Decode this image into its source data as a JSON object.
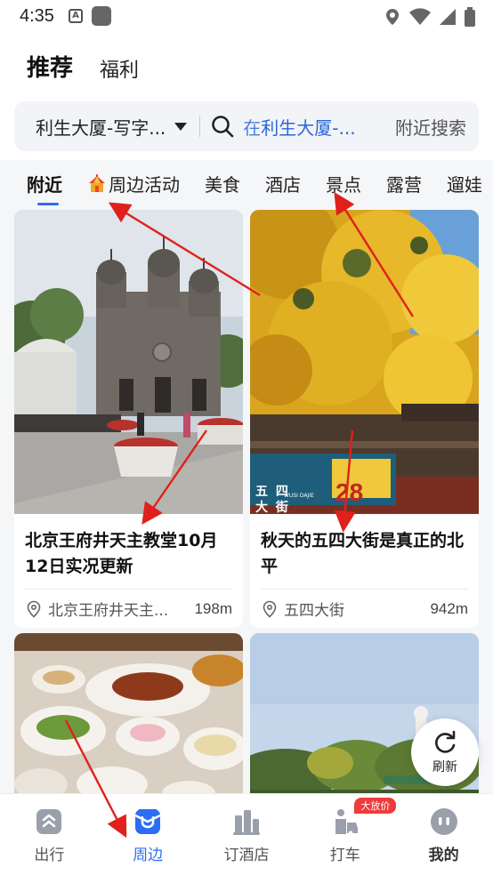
{
  "status_bar": {
    "time": "4:35",
    "a_glyph": "A"
  },
  "top_tabs": [
    {
      "label": "推荐",
      "active": true
    },
    {
      "label": "福利",
      "active": false
    }
  ],
  "search": {
    "location": "利生大厦-写字...",
    "hint_prefix": "在",
    "hint_place": "利生大厦-...",
    "nearby_button": "附近搜索"
  },
  "categories": [
    "附近",
    "周边活动",
    "美食",
    "酒店",
    "景点",
    "露营",
    "遛娃"
  ],
  "cards": [
    {
      "title": "北京王府井天主教堂10月12日实况更新",
      "location": "北京王府井天主...",
      "distance": "198m"
    },
    {
      "title": "秋天的五四大街是真正的北平",
      "location": "五四大街",
      "distance": "942m"
    },
    {
      "title": "",
      "location": "",
      "distance": ""
    },
    {
      "title": "",
      "location": "",
      "distance": ""
    }
  ],
  "street_sign": {
    "row1": "五 四",
    "row2": "大 街",
    "number": "28",
    "romanized": "WUSI DAJIE"
  },
  "refresh": {
    "label": "刷新"
  },
  "bottom_nav": [
    {
      "label": "出行",
      "icon": "travel-icon",
      "active": false
    },
    {
      "label": "周边",
      "icon": "nearby-icon",
      "active": true
    },
    {
      "label": "订酒店",
      "icon": "hotel-icon",
      "active": false
    },
    {
      "label": "打车",
      "icon": "taxi-icon",
      "active": false,
      "badge": "大放价"
    },
    {
      "label": "我的",
      "icon": "profile-icon",
      "active": false
    }
  ],
  "colors": {
    "accent": "#2c6ef2",
    "annotation_arrow": "#e0201c",
    "badge": "#ef3b3b"
  }
}
